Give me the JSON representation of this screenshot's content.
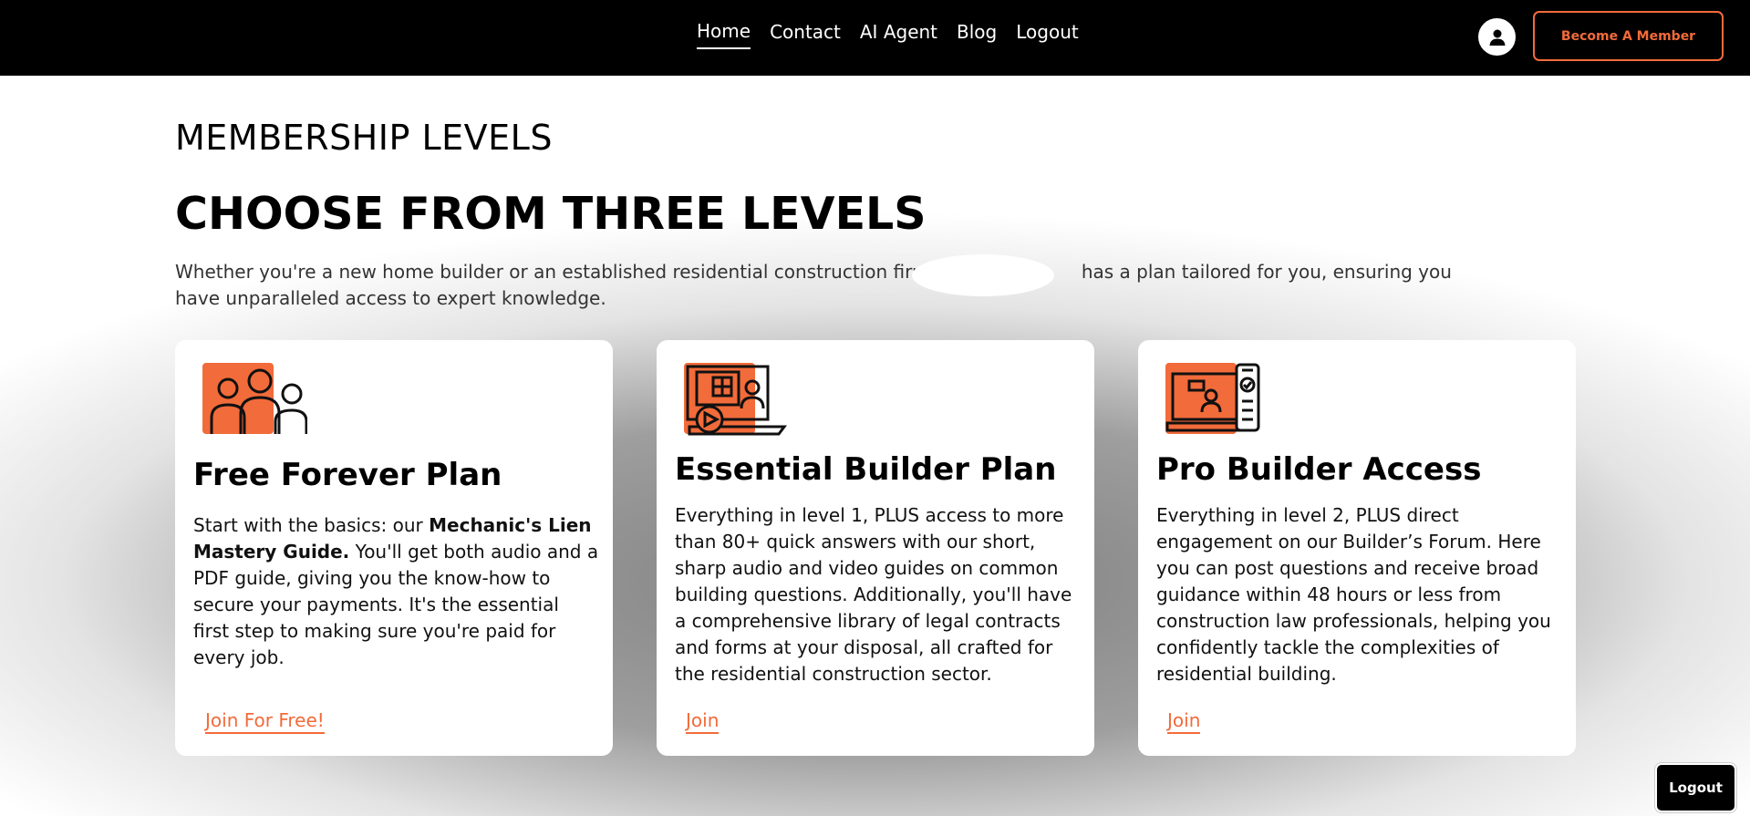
{
  "nav": {
    "links": [
      {
        "label": "Home",
        "active": true
      },
      {
        "label": "Contact",
        "active": false
      },
      {
        "label": "AI Agent",
        "active": false
      },
      {
        "label": "Blog",
        "active": false
      },
      {
        "label": "Logout",
        "active": false
      }
    ],
    "avatar_icon": "user-icon",
    "member_button": "Become A Member"
  },
  "section": {
    "eyebrow": "MEMBERSHIP LEVELS",
    "headline": "CHOOSE FROM THREE LEVELS",
    "intro_before": "Whether you're a new home builder or an established residential construction firm,",
    "intro_after": "has a plan tailored for you, ensuring you have unparalleled access to expert knowledge."
  },
  "plans": [
    {
      "icon": "team-icon",
      "title": "Free Forever Plan",
      "body_before": "Start with the basics: our ",
      "body_strong": "Mechanic's Lien Mastery Guide.",
      "body_after": " You'll get both audio and a PDF guide, giving you the know-how to secure your payments. It's the essential first step to making sure you're paid for every job.",
      "link": "Join For Free!"
    },
    {
      "icon": "video-guide-icon",
      "title": "Essential Builder Plan",
      "body": "Everything in level 1, PLUS access to more than 80+ quick answers with our short, sharp audio and video guides on common building questions. Additionally, you'll have a comprehensive library of legal contracts and forms at your disposal, all crafted for the residential construction sector.",
      "link": "Join"
    },
    {
      "icon": "forum-laptop-icon",
      "title": "Pro Builder Access",
      "body": "Everything in level 2, PLUS direct engagement on our Builder’s Forum. Here you can post questions and receive broad guidance within 48 hours or less from construction law professionals, helping you confidently tackle the complexities of residential building.",
      "link": "Join"
    }
  ],
  "floating": {
    "logout": "Logout"
  },
  "colors": {
    "accent": "#f26b3a",
    "header_bg": "#000000"
  }
}
